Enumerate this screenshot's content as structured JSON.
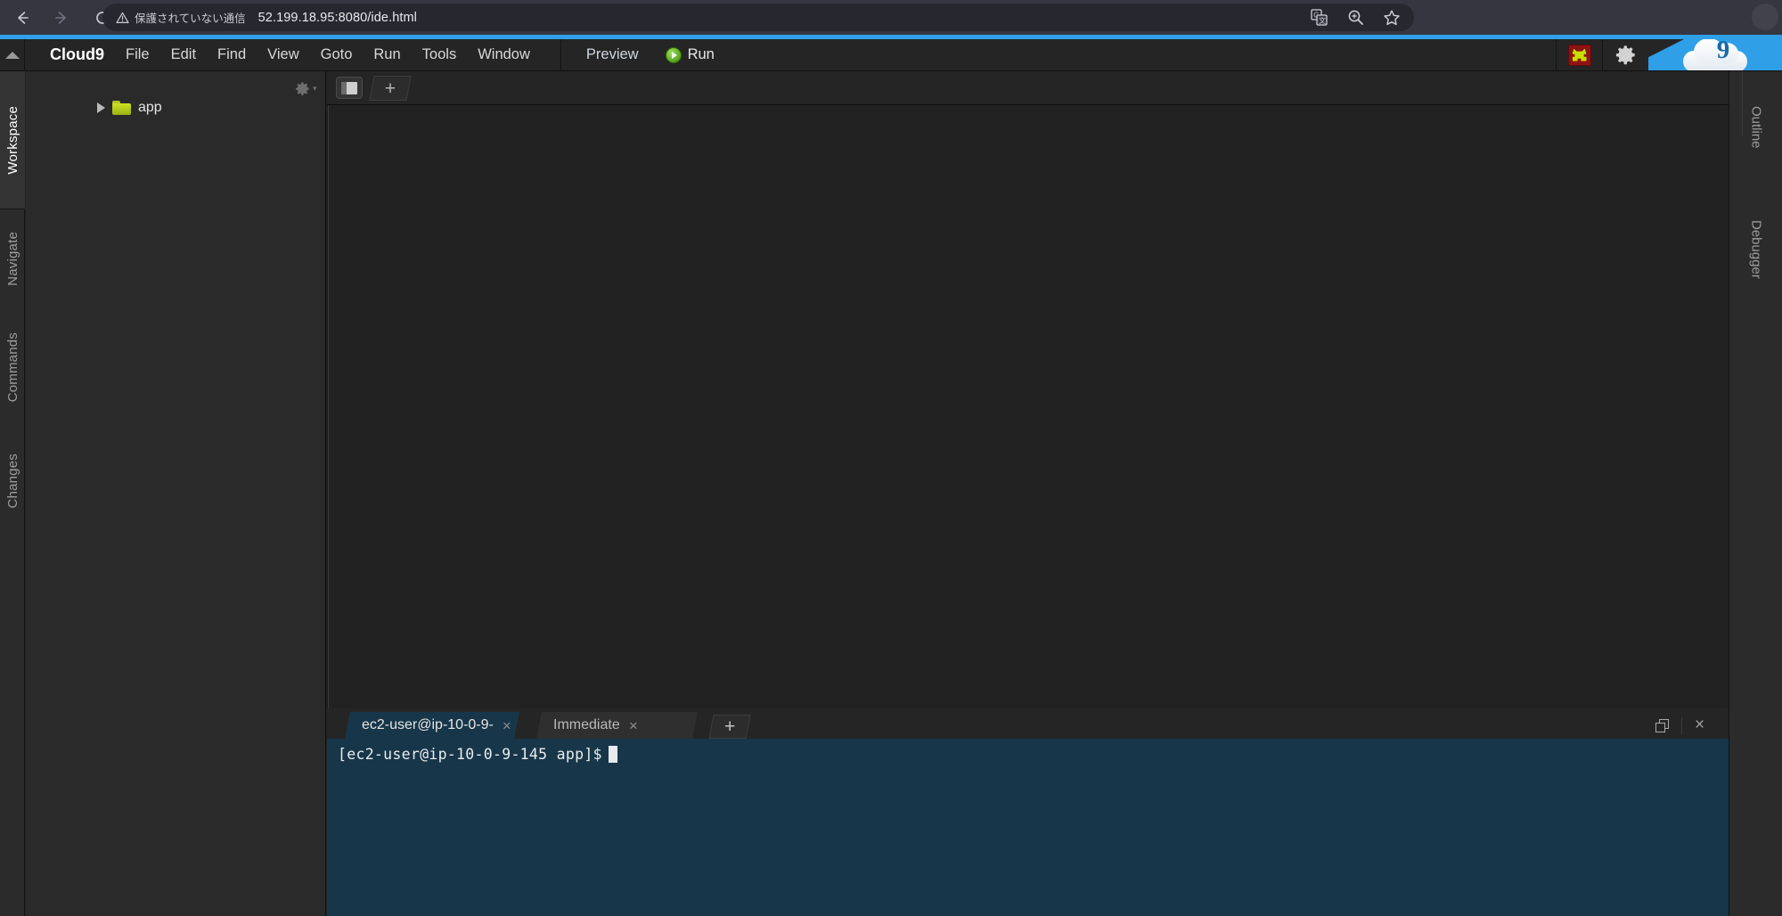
{
  "browser": {
    "back_icon": "back-arrow-icon",
    "forward_icon": "forward-arrow-icon",
    "reload_icon": "reload-icon",
    "security_label": "保護されていない通信",
    "security_icon": "warning-triangle-icon",
    "url": "52.199.18.95:8080/ide.html",
    "actions": [
      {
        "name": "translate-icon",
        "glyph": "G"
      },
      {
        "name": "zoom-icon",
        "glyph": "⌕"
      },
      {
        "name": "bookmark-star-icon",
        "glyph": "☆"
      }
    ]
  },
  "ide": {
    "accent_color": "#2f9fe8",
    "brand": "Cloud9",
    "menu": [
      "File",
      "Edit",
      "Find",
      "View",
      "Goto",
      "Run",
      "Tools",
      "Window"
    ],
    "preview_label": "Preview",
    "run_label": "Run",
    "run_icon": "green-play-icon",
    "bug_icon": "bug-icon",
    "gear_icon": "gear-icon",
    "logo_icon": "cloud9-logo-icon",
    "logo_digit": "9",
    "collapse_icon": "collapse-up-arrow-icon"
  },
  "left_rail": {
    "tabs": [
      {
        "label": "Workspace",
        "active": true
      },
      {
        "label": "Navigate",
        "active": false
      },
      {
        "label": "Commands",
        "active": false
      },
      {
        "label": "Changes",
        "active": false
      }
    ]
  },
  "tree": {
    "gear_icon": "tree-settings-gear-icon",
    "caret_icon": "collapsed-caret-icon",
    "folder_icon": "folder-icon",
    "root_label": "app"
  },
  "editor": {
    "panel_toggle_icon": "toggle-panel-icon",
    "new_tab_icon": "plus-icon",
    "new_tab_label": "+"
  },
  "terminal": {
    "tabs": [
      {
        "label": "ec2-user@ip-10-0-9-",
        "active": true,
        "close_icon": "close-icon",
        "close_label": "×"
      },
      {
        "label": "Immediate",
        "active": false,
        "close_icon": "close-icon",
        "close_label": "×"
      }
    ],
    "new_tab_label": "+",
    "maximize_icon": "restore-window-icon",
    "close_icon": "close-panel-icon",
    "close_label": "×",
    "prompt": "[ec2-user@ip-10-0-9-145 app]$",
    "background_color": "#173649"
  },
  "right_rail": {
    "tabs": [
      {
        "label": "Outline"
      },
      {
        "label": "Debugger"
      }
    ]
  }
}
